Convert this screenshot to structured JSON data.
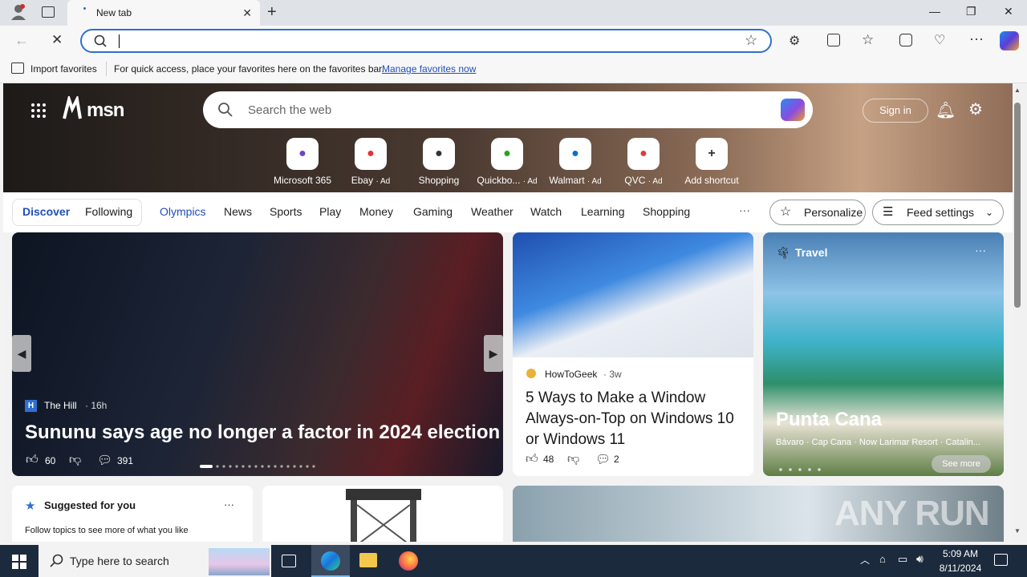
{
  "browser": {
    "tab_title": "New tab",
    "address_value": "",
    "favorites": {
      "import_label": "Import favorites",
      "message": "For quick access, place your favorites here on the favorites bar.",
      "manage_link": "Manage favorites now"
    }
  },
  "msn": {
    "logo": "msn",
    "search_placeholder": "Search the web",
    "sign_in": "Sign in",
    "shortcuts": [
      {
        "label": "Microsoft 365",
        "ad": "",
        "icon": "microsoft365-icon",
        "color": "#6b46c1"
      },
      {
        "label": "Ebay",
        "ad": "· Ad",
        "icon": "ebay-icon",
        "color": "#e53238"
      },
      {
        "label": "Shopping",
        "ad": "",
        "icon": "shopping-tag-icon",
        "color": "#333"
      },
      {
        "label": "Quickbo...",
        "ad": "· Ad",
        "icon": "quickbooks-icon",
        "color": "#2ca01c"
      },
      {
        "label": "Walmart",
        "ad": "· Ad",
        "icon": "walmart-icon",
        "color": "#0071ce"
      },
      {
        "label": "QVC",
        "ad": "· Ad",
        "icon": "qvc-icon",
        "color": "#e03a3e"
      },
      {
        "label": "Add shortcut",
        "ad": "",
        "icon": "plus-icon",
        "color": "#333"
      }
    ],
    "nav": {
      "discover": "Discover",
      "following": "Following",
      "items": [
        "Olympics",
        "News",
        "Sports",
        "Play",
        "Money",
        "Gaming",
        "Weather",
        "Watch",
        "Learning",
        "Shopping"
      ],
      "more": "···",
      "personalize": "Personalize",
      "feed_settings": "Feed settings"
    },
    "cards": {
      "main": {
        "source": "The Hill",
        "time": "· 16h",
        "headline": "Sununu says age no longer a factor in 2024 election",
        "likes": "60",
        "comments": "391"
      },
      "howto": {
        "source": "HowToGeek",
        "time": "· 3w",
        "headline": "5 Ways to Make a Window Always-on-Top on Windows 10 or Windows 11",
        "likes": "48",
        "comments": "2"
      },
      "travel": {
        "category": "Travel",
        "title": "Punta Cana",
        "subtitle": "Bávaro · Cap Cana · Now Larimar Resort · Catalin...",
        "see_more": "See more"
      },
      "suggested": {
        "title": "Suggested for you",
        "text": "Follow topics to see more of what you like",
        "more": "···"
      }
    }
  },
  "taskbar": {
    "search_placeholder": "Type here to search",
    "time": "5:09 AM",
    "date": "8/11/2024"
  },
  "watermark": "ANY RUN"
}
